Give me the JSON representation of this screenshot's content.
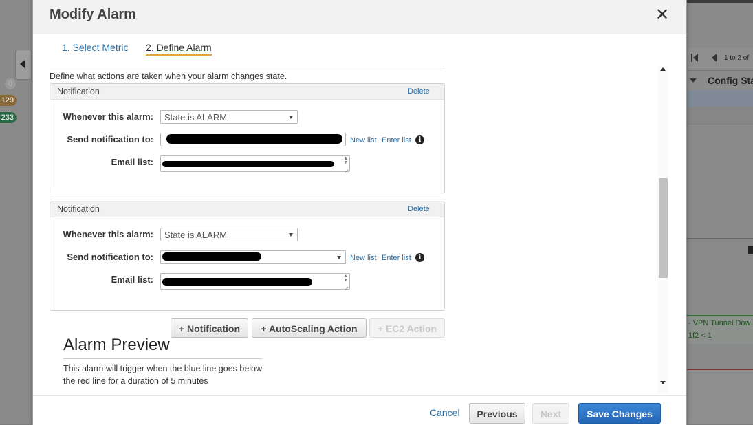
{
  "background": {
    "badges": [
      "0",
      "129",
      "233"
    ],
    "pager_text": "1 to 2 of",
    "column_header": "Config Sta",
    "alert_line1": "- VPN Tunnel Dow",
    "alert_line2": "1f2 < 1"
  },
  "modal": {
    "title": "Modify Alarm",
    "close_symbol": "✕",
    "steps": [
      "1. Select Metric",
      "2. Define Alarm"
    ],
    "intro": "Define what actions are taken when your alarm changes state.",
    "notifications": [
      {
        "title": "Notification",
        "delete_label": "Delete",
        "whenever_label": "Whenever this alarm:",
        "state_value": "State is ALARM",
        "send_label": "Send notification to:",
        "new_list": "New list",
        "enter_list": "Enter list",
        "email_label": "Email list:"
      },
      {
        "title": "Notification",
        "delete_label": "Delete",
        "whenever_label": "Whenever this alarm:",
        "state_value": "State is ALARM",
        "send_label": "Send notification to:",
        "new_list": "New list",
        "enter_list": "Enter list",
        "email_label": "Email list:"
      }
    ],
    "actions": {
      "notification": "+ Notification",
      "autoscaling": "+ AutoScaling Action",
      "ec2": "+ EC2 Action"
    },
    "preview": {
      "title": "Alarm Preview",
      "text": "This alarm will trigger when the blue line goes below the red line for a duration of 5 minutes"
    },
    "footer": {
      "cancel": "Cancel",
      "previous": "Previous",
      "next": "Next",
      "save": "Save Changes"
    }
  },
  "colors": {
    "link": "#2a6ea5",
    "primary_button": "#2468b8",
    "active_step_underline": "#e5a435"
  }
}
